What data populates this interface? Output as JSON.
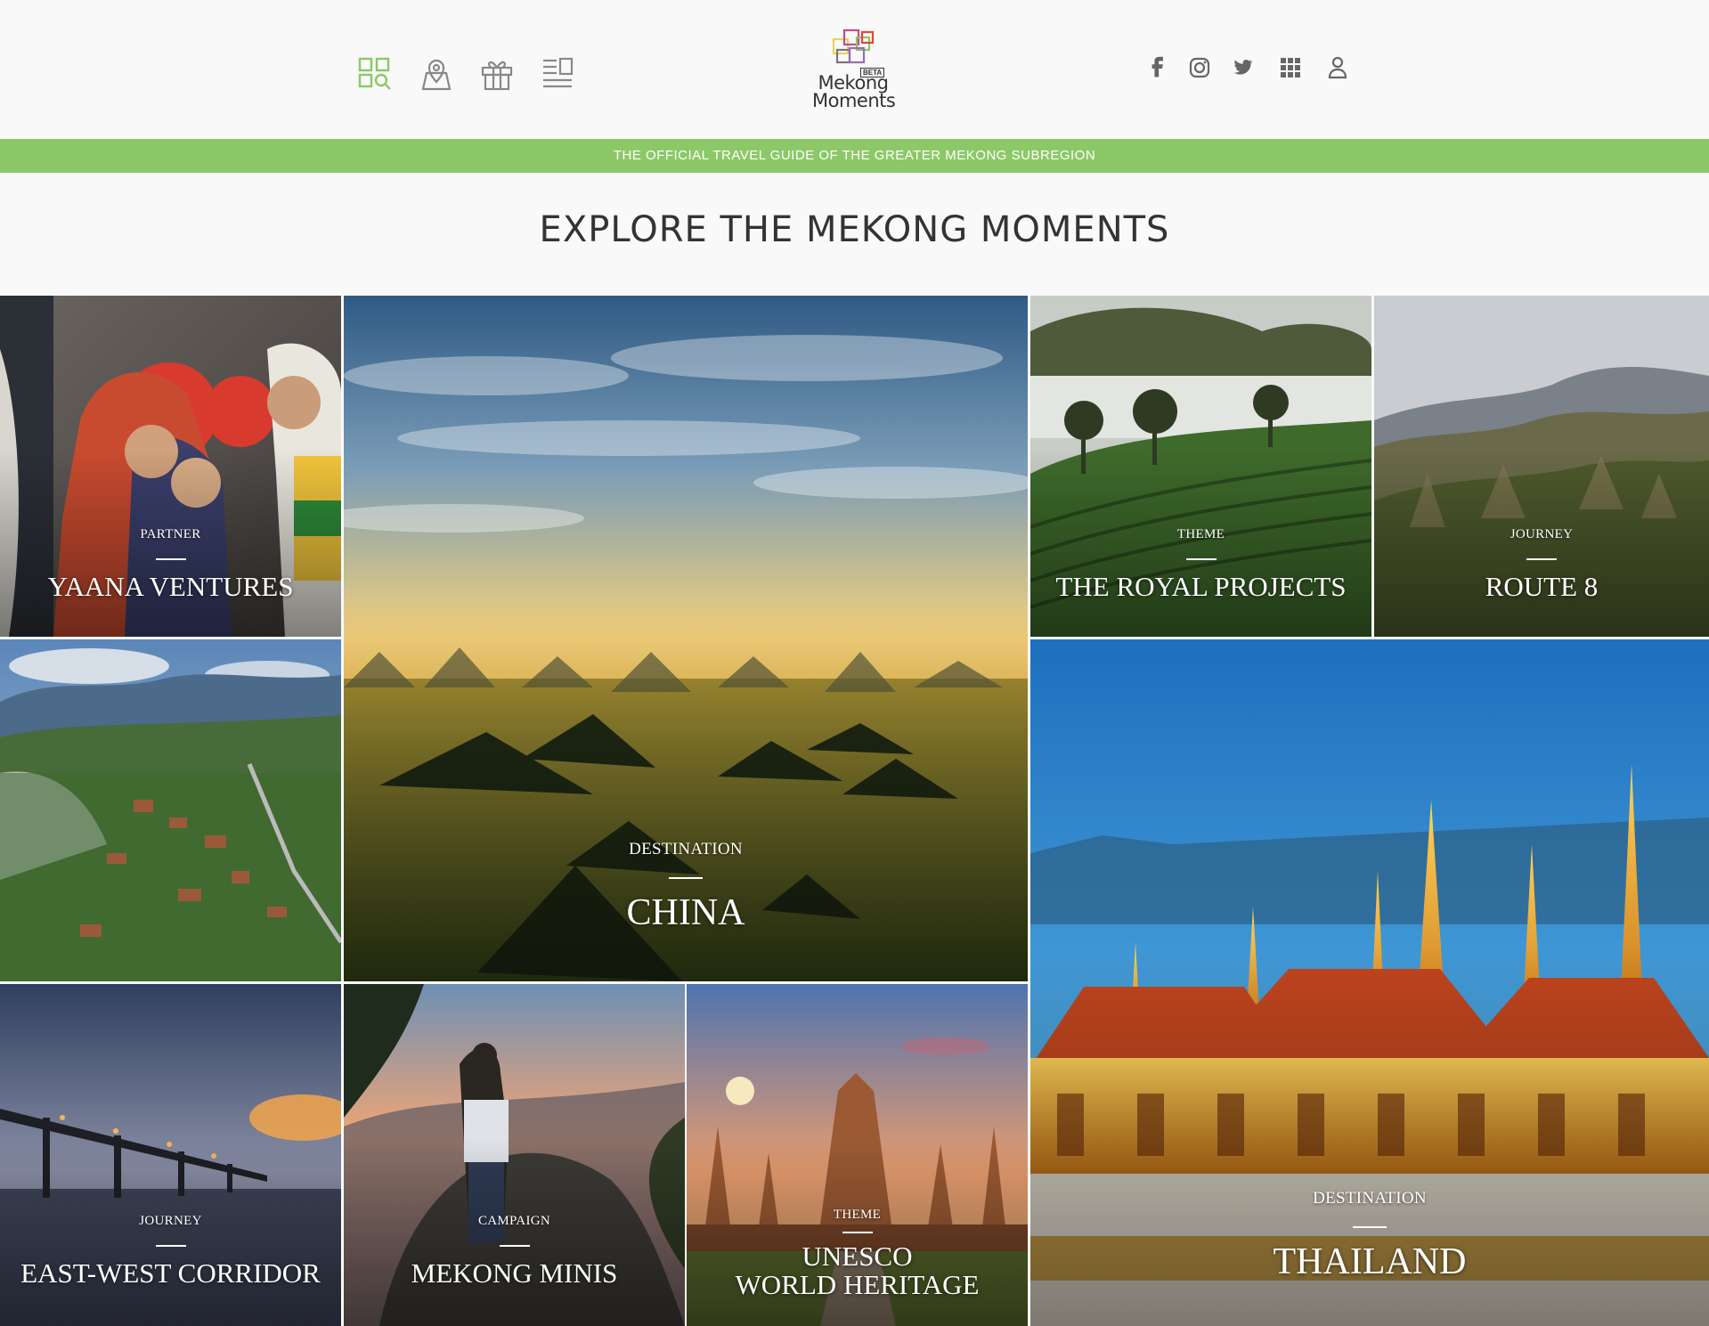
{
  "header": {
    "nav_icons": [
      {
        "name": "discover-icon",
        "color": "#8cc868"
      },
      {
        "name": "map-pin-icon",
        "color": "#888888"
      },
      {
        "name": "gift-icon",
        "color": "#888888"
      },
      {
        "name": "news-icon",
        "color": "#888888"
      }
    ],
    "logo": {
      "line1": "Mekong",
      "line2": "Moments",
      "badge": "BETA"
    },
    "social_icons": [
      "facebook-icon",
      "instagram-icon",
      "twitter-icon",
      "apps-grid-icon",
      "user-icon"
    ]
  },
  "banner": {
    "text": "THE OFFICIAL TRAVEL GUIDE OF THE GREATER MEKONG SUBREGION",
    "color": "#8cc868"
  },
  "page_title": "EXPLORE THE MEKONG MOMENTS",
  "tiles": {
    "yaana": {
      "category": "PARTNER",
      "name": "YAANA VENTURES"
    },
    "china": {
      "category": "DESTINATION",
      "name": "CHINA"
    },
    "royal": {
      "category": "THEME",
      "name": "THE ROYAL PROJECTS"
    },
    "route8": {
      "category": "JOURNEY",
      "name": "ROUTE 8"
    },
    "laos": {
      "category": "",
      "name": ""
    },
    "thailand": {
      "category": "DESTINATION",
      "name": "THAILAND"
    },
    "eastwest": {
      "category": "JOURNEY",
      "name": "EAST-WEST CORRIDOR"
    },
    "minis": {
      "category": "CAMPAIGN",
      "name": "MEKONG MINIS"
    },
    "unesco": {
      "category": "THEME",
      "name": "UNESCO\nWORLD HERITAGE"
    }
  }
}
